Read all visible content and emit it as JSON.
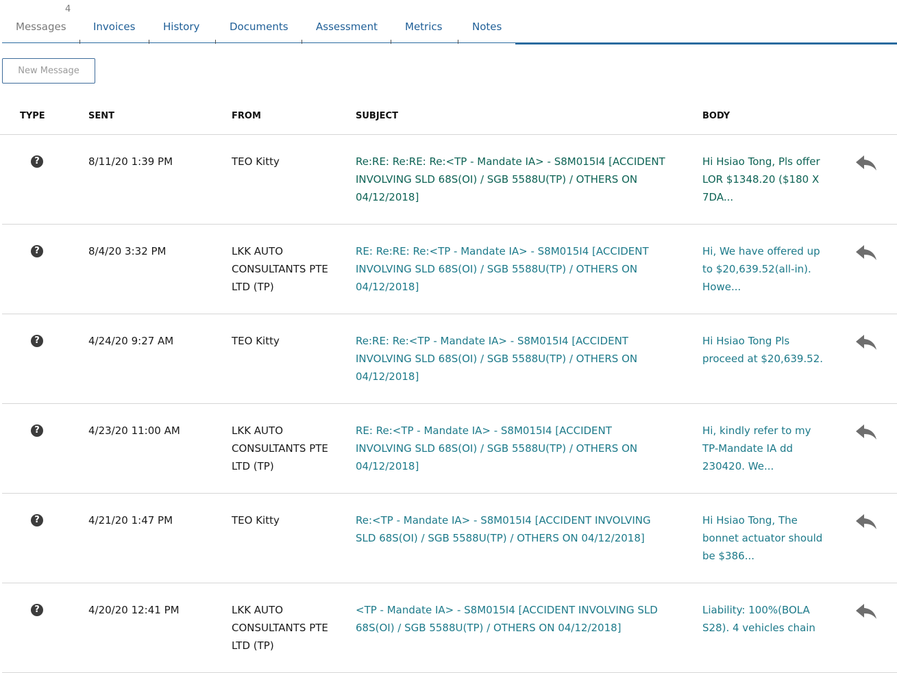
{
  "tabs": [
    {
      "label": "Messages",
      "count": "4",
      "active": true
    },
    {
      "label": "Invoices"
    },
    {
      "label": "History"
    },
    {
      "label": "Documents"
    },
    {
      "label": "Assessment"
    },
    {
      "label": "Metrics"
    },
    {
      "label": "Notes"
    }
  ],
  "toolbar": {
    "new_message_label": "New Message"
  },
  "columns": {
    "type": "TYPE",
    "sent": "SENT",
    "from": "FROM",
    "subject": "SUBJECT",
    "body": "BODY"
  },
  "icons": {
    "type": "help-circle-icon",
    "reply": "reply-icon"
  },
  "colors": {
    "link": "#1f5f97",
    "subject": "#1d7a8a",
    "unread": "#0e6355",
    "accent": "#2a6b9f"
  },
  "messages": [
    {
      "sent": "8/11/20 1:39 PM",
      "from": "TEO Kitty",
      "subject": "Re:RE: Re:RE: Re:<TP - Mandate IA> - S8M015I4 [ACCIDENT INVOLVING SLD 68S(OI) / SGB 5588U(TP) / OTHERS ON 04/12/2018]",
      "body": "Hi Hsiao Tong, Pls offer LOR $1348.20 ($180 X 7DA...",
      "unread": true
    },
    {
      "sent": "8/4/20 3:32 PM",
      "from": "LKK AUTO CONSULTANTS PTE LTD (TP)",
      "subject": "RE: Re:RE: Re:<TP - Mandate IA> - S8M015I4 [ACCIDENT INVOLVING SLD 68S(OI) / SGB 5588U(TP) / OTHERS ON 04/12/2018]",
      "body": "Hi, We have offered up to $20,639.52(all-in). Howe...",
      "unread": false
    },
    {
      "sent": "4/24/20 9:27 AM",
      "from": "TEO Kitty",
      "subject": "Re:RE: Re:<TP - Mandate IA> - S8M015I4 [ACCIDENT INVOLVING SLD 68S(OI) / SGB 5588U(TP) / OTHERS ON 04/12/2018]",
      "body": "Hi Hsiao Tong Pls proceed at $20,639.52.",
      "unread": false
    },
    {
      "sent": "4/23/20 11:00 AM",
      "from": "LKK AUTO CONSULTANTS PTE LTD (TP)",
      "subject": "RE: Re:<TP - Mandate IA> - S8M015I4 [ACCIDENT INVOLVING SLD 68S(OI) / SGB 5588U(TP) / OTHERS ON 04/12/2018]",
      "body": "Hi, kindly refer to my TP-Mandate IA dd 230420. We...",
      "unread": false
    },
    {
      "sent": "4/21/20 1:47 PM",
      "from": "TEO Kitty",
      "subject": "Re:<TP - Mandate IA> - S8M015I4 [ACCIDENT INVOLVING SLD 68S(OI) / SGB 5588U(TP) / OTHERS ON 04/12/2018]",
      "body": "Hi Hsiao Tong, The bonnet actuator should be $386...",
      "unread": false
    },
    {
      "sent": "4/20/20 12:41 PM",
      "from": "LKK AUTO CONSULTANTS PTE LTD (TP)",
      "subject": "<TP - Mandate IA> - S8M015I4 [ACCIDENT INVOLVING SLD 68S(OI) / SGB 5588U(TP) / OTHERS ON 04/12/2018]",
      "body": "Liability: 100%(BOLA S28). 4 vehicles chain",
      "unread": false
    }
  ]
}
